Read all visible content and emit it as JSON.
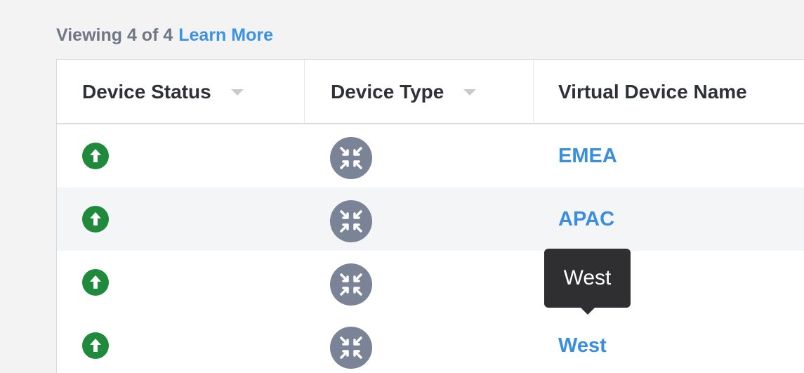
{
  "header": {
    "viewing_text": "Viewing 4 of 4",
    "learn_more": "Learn More"
  },
  "table": {
    "columns": [
      {
        "label": "Device Status"
      },
      {
        "label": "Device Type"
      },
      {
        "label": "Virtual Device Name"
      }
    ],
    "rows": [
      {
        "status": "up",
        "status_icon": "arrow-up-circle-icon",
        "type_icon": "router-icon",
        "name": "EMEA"
      },
      {
        "status": "up",
        "status_icon": "arrow-up-circle-icon",
        "type_icon": "router-icon",
        "name": "APAC"
      },
      {
        "status": "up",
        "status_icon": "arrow-up-circle-icon",
        "type_icon": "router-icon",
        "name": ""
      },
      {
        "status": "up",
        "status_icon": "arrow-up-circle-icon",
        "type_icon": "router-icon",
        "name": "West"
      }
    ]
  },
  "tooltip": {
    "text": "West"
  },
  "colors": {
    "status_up": "#1f8a3b",
    "device_icon": "#7a8496",
    "link": "#3a8ee0",
    "tooltip_bg": "#2f2f31"
  }
}
